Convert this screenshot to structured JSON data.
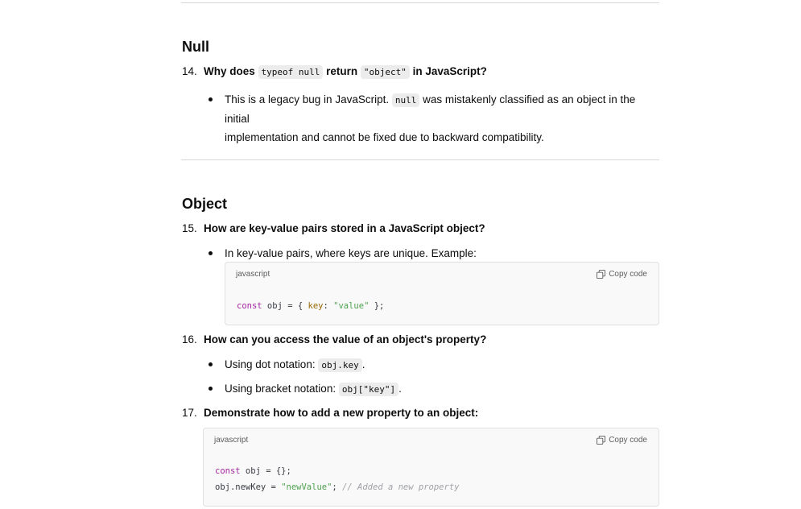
{
  "sections": [
    {
      "heading": "Null",
      "questions": [
        {
          "number": "14.",
          "parts": {
            "a": "Why does ",
            "code1": "typeof null",
            "b": " return ",
            "code2": "\"object\"",
            "c": " in JavaScript?"
          },
          "bullets": [
            {
              "line1_a": "This is a legacy bug in JavaScript. ",
              "line1_code": "null",
              "line1_b": " was mistakenly classified as an object in the initial",
              "line2": "implementation and cannot be fixed due to backward compatibility."
            }
          ]
        }
      ]
    },
    {
      "heading": "Object",
      "questions": [
        {
          "number": "15.",
          "text": "How are key-value pairs stored in a JavaScript object?",
          "bullet": "In key-value pairs, where keys are unique. Example:",
          "code_block": {
            "lang": "javascript",
            "copy_label": "Copy code",
            "tokens": {
              "kw": "const",
              "plain1": " obj = { ",
              "prop": "key",
              "plain2": ": ",
              "str": "\"value\"",
              "plain3": " };"
            }
          }
        },
        {
          "number": "16.",
          "text": "How can you access the value of an object's property?",
          "bullets": [
            {
              "label": "Using dot notation: ",
              "code": "obj.key",
              "end": "."
            },
            {
              "label": "Using bracket notation: ",
              "code": "obj[\"key\"]",
              "end": "."
            }
          ]
        },
        {
          "number": "17.",
          "text": "Demonstrate how to add a new property to an object:",
          "code_block": {
            "lang": "javascript",
            "copy_label": "Copy code",
            "line1": {
              "kw": "const",
              "plain": " obj = {};"
            },
            "line2": {
              "plain1": "obj.newKey = ",
              "str": "\"newValue\"",
              "plain2": "; ",
              "cmt": "// Added a new property"
            }
          }
        }
      ]
    }
  ]
}
